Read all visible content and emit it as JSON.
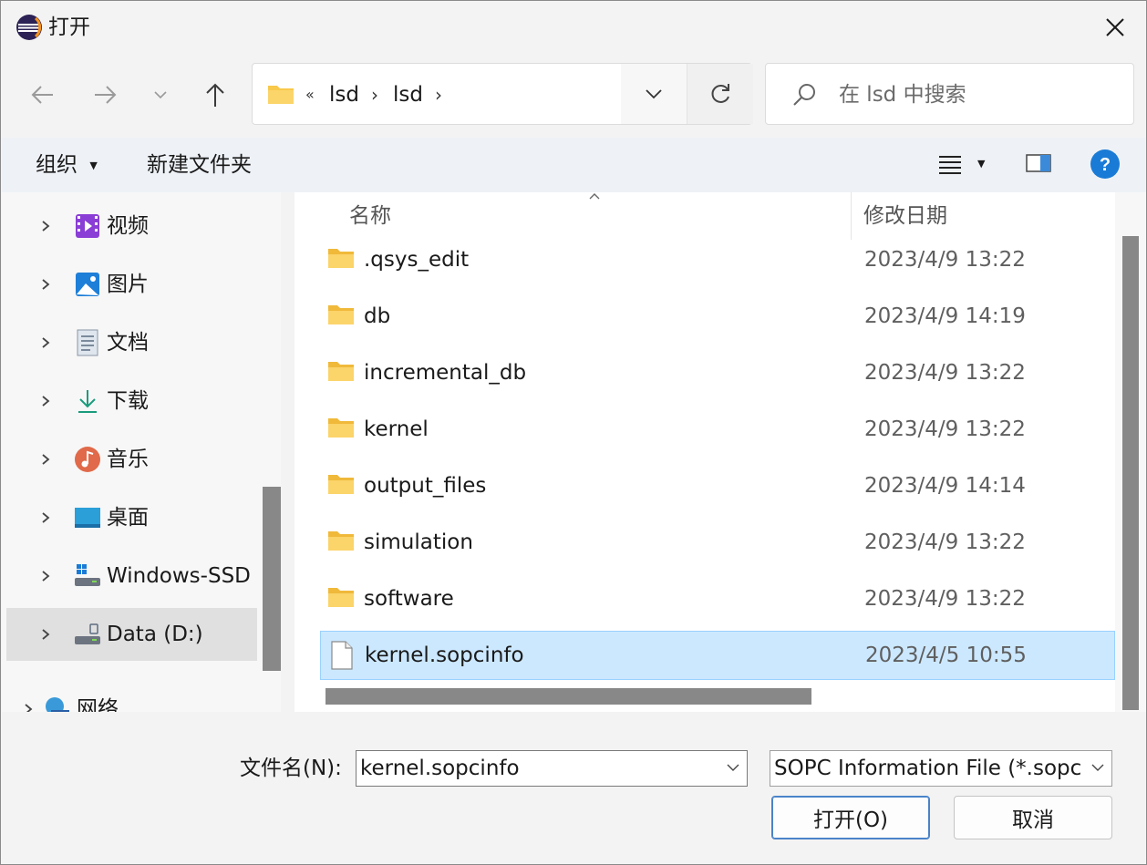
{
  "window": {
    "title": "打开"
  },
  "nav": {
    "back": "back",
    "forward": "forward",
    "recent": "recent",
    "up": "up"
  },
  "address": {
    "overflow": "«",
    "crumbs": [
      "lsd",
      "lsd"
    ],
    "separator": "›"
  },
  "search": {
    "placeholder": "在 lsd 中搜索"
  },
  "toolbar": {
    "organize": "组织",
    "new_folder": "新建文件夹"
  },
  "sidebar": {
    "items": [
      {
        "label": "视频",
        "icon": "video-icon"
      },
      {
        "label": "图片",
        "icon": "pictures-icon"
      },
      {
        "label": "文档",
        "icon": "documents-icon"
      },
      {
        "label": "下载",
        "icon": "download-icon"
      },
      {
        "label": "音乐",
        "icon": "music-icon"
      },
      {
        "label": "桌面",
        "icon": "desktop-icon"
      },
      {
        "label": "Windows-SSD",
        "icon": "drive-icon"
      },
      {
        "label": "Data (D:)",
        "icon": "drive-icon",
        "selected": true
      },
      {
        "label": "网络",
        "icon": "network-icon"
      }
    ]
  },
  "files": {
    "columns": [
      "名称",
      "修改日期"
    ],
    "rows": [
      {
        "name": ".qsys_edit",
        "date": "2023/4/9 13:22",
        "type": "folder"
      },
      {
        "name": "db",
        "date": "2023/4/9 14:19",
        "type": "folder"
      },
      {
        "name": "incremental_db",
        "date": "2023/4/9 13:22",
        "type": "folder"
      },
      {
        "name": "kernel",
        "date": "2023/4/9 13:22",
        "type": "folder"
      },
      {
        "name": "output_files",
        "date": "2023/4/9 14:14",
        "type": "folder"
      },
      {
        "name": "simulation",
        "date": "2023/4/9 13:22",
        "type": "folder"
      },
      {
        "name": "software",
        "date": "2023/4/9 13:22",
        "type": "folder"
      },
      {
        "name": "kernel.sopcinfo",
        "date": "2023/4/5 10:55",
        "type": "file",
        "selected": true
      }
    ]
  },
  "footer": {
    "filename_label": "文件名(N):",
    "filename_value": "kernel.sopcinfo",
    "filetype_value": "SOPC Information File (*.sopcinfo)",
    "open_button": "打开(O)",
    "cancel_button": "取消"
  },
  "colors": {
    "accent": "#0078d4",
    "selected_row": "#cce8ff",
    "folder": "#f8c94a"
  }
}
